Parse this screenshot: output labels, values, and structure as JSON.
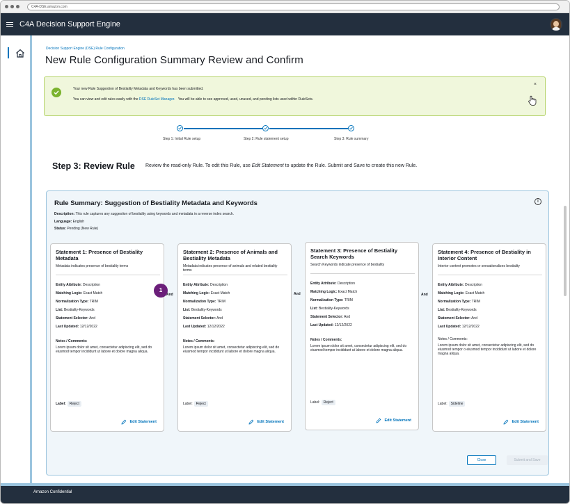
{
  "browser": {
    "url": "C4A-DSE.amazon.com"
  },
  "app": {
    "title": "C4A Decision Support Engine"
  },
  "breadcrumb": "Decision Support Engine (DSE) Rule Configuration",
  "page_title": "New Rule Configuration Summary Review and Confirm",
  "alert": {
    "line1": "Your new Rule Suggestion of Bestiality Metadata and Keywords has been submitted.",
    "line2_pre": "You can view and edit rules easily with the",
    "line2_link": "DSE RuleSet Manager.",
    "line2_post": "You will be able to see approved, used, unused, and pending lists used within RuleSets.",
    "close": "×"
  },
  "stepper": {
    "steps": [
      {
        "label": "Step 1: Initial Rule setup"
      },
      {
        "label": "Step 2: Rule statement setup"
      },
      {
        "label": "Step 3: Rule summary"
      }
    ]
  },
  "step3": {
    "heading": "Step 3:  Review Rule",
    "desc_pre": "Review the read-only Rule. To edit this Rule, use",
    "desc_em": "Edit Statement",
    "desc_post": "to update the Rule.  Submit and Save to create this new Rule."
  },
  "summary": {
    "title": "Rule Summary:  Suggestion of Bestiality Metadata and Keywords",
    "description_label": "Description:",
    "description": "This rule captures any suggestion of bestiality using keywords  and metadata in a reverse index search.",
    "language_label": "Language:",
    "language": "English",
    "status_label": "Status:",
    "status": "Pending (New Rule)",
    "info": "i"
  },
  "connector": "And",
  "badge": "1",
  "field_labels": {
    "entity": "Entity Attribute:",
    "matching": "Matching Logic:",
    "normalization": "Normalization Type:",
    "list": "List:",
    "selector": "Statement Selector:",
    "updated": "Last Updated:",
    "notes": "Notes / Comments:",
    "label": "Label:"
  },
  "edit_label": "Edit Statement",
  "statements": [
    {
      "title": "Statement 1: Presence of Bestiality Metadata",
      "desc": "Metadata indicates presence of bestiality terms",
      "entity": "Description",
      "matching": "Exact Match",
      "normalization": "TRIM",
      "list": "Bestiality-Keywords",
      "selector": "And",
      "updated": "12/12/2022",
      "notes": "Lorem ipsum dolor sit amet, consectetur adipiscing elit, sed do eiusmod tempor incididunt ut labore et dolore magna aliqua.",
      "label": "Reject"
    },
    {
      "title": "Statement 2: Presence of Animals and Bestiality Metadata",
      "desc": "Metadata indicates presence of animals and related bestiality terms",
      "entity": "Description",
      "matching": "Exact Match",
      "normalization": "TRIM",
      "list": "Bestiality-Keywords",
      "selector": "And",
      "updated": "12/12/2022",
      "notes": "Lorem ipsum dolor sit amet, consectetur adipiscing elit, sed do eiusmod tempor incididunt ut labore et dolore magna aliqua.",
      "label": "Reject"
    },
    {
      "title": "Statement 3: Presence of Bestiality Search Keywords",
      "desc": "Search Keywords indicate presence of bestiality",
      "entity": "Description",
      "matching": "Exact Match",
      "normalization": "TRIM",
      "list": "Bestiality-Keywords",
      "selector": "And",
      "updated": "12/12/2022",
      "notes": "Lorem ipsum dolor sit amet, consectetur adipiscing elit, sed do eiusmod tempor incididunt ut labore et dolore magna aliqua.",
      "label": "Reject"
    },
    {
      "title": "Statement 4: Presence of Bestiality in Interior Content",
      "desc": "Interior content promotes or sensationalizes bestiality",
      "entity": "Description",
      "matching": "Exact Match",
      "normalization": "TRIM",
      "list": "Bestiality-Keywords",
      "selector": "And",
      "updated": "12/12/2022",
      "notes": "Lorem ipsum dolor sit amet, consectetur adipiscing elit, sed do eiusmod tempor o eiusmod tempor incididunt ut labore et dolore magna aliqua.",
      "label": "Sideline"
    }
  ],
  "buttons": {
    "close": "Close",
    "submit": "Submit and Save"
  },
  "footer": "Amazon Confidential",
  "colors": {
    "header": "#232f3e",
    "accent": "#0073bb",
    "success": "#7bb32e",
    "badge": "#6b1f7a"
  }
}
